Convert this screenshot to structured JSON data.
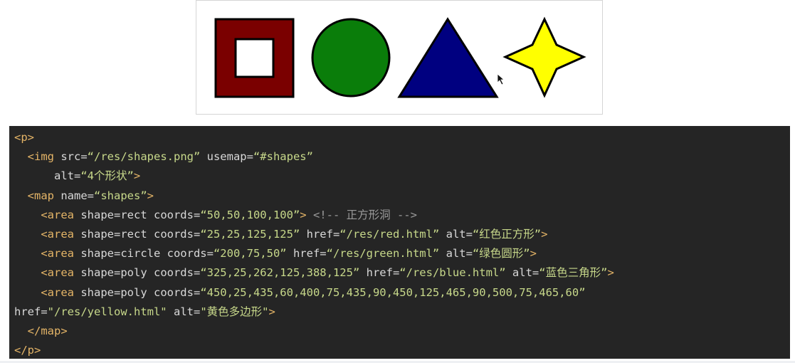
{
  "figure": {
    "shapes": [
      {
        "name": "red-square-frame",
        "fill": "#7a0000",
        "hole": "#ffffff"
      },
      {
        "name": "green-circle",
        "fill": "#0a7d0a"
      },
      {
        "name": "blue-triangle",
        "fill": "#000080"
      },
      {
        "name": "yellow-star",
        "fill": "#ffff00"
      }
    ],
    "stroke_color": "#000000"
  },
  "code": {
    "lines": [
      [
        {
          "t": "tag",
          "v": "<p>"
        }
      ],
      [
        {
          "t": "tag",
          "v": "  <img"
        },
        {
          "t": "attr",
          "v": " src="
        },
        {
          "t": "val",
          "v": "“/res/shapes.png”"
        },
        {
          "t": "attr",
          "v": " usemap="
        },
        {
          "t": "val",
          "v": "“#shapes”"
        }
      ],
      [
        {
          "t": "attr",
          "v": "      alt="
        },
        {
          "t": "val",
          "v": "“4个形状”"
        },
        {
          "t": "tag",
          "v": ">"
        }
      ],
      [
        {
          "t": "tag",
          "v": "  <map"
        },
        {
          "t": "attr",
          "v": " name="
        },
        {
          "t": "val",
          "v": "“shapes”"
        },
        {
          "t": "tag",
          "v": ">"
        }
      ],
      [
        {
          "t": "tag",
          "v": "    <area"
        },
        {
          "t": "attr",
          "v": " shape=rect coords="
        },
        {
          "t": "val",
          "v": "“50,50,100,100”"
        },
        {
          "t": "tag",
          "v": ">"
        },
        {
          "t": "cmt",
          "v": " <!-- 正方形洞 -->"
        }
      ],
      [
        {
          "t": "tag",
          "v": "    <area"
        },
        {
          "t": "attr",
          "v": " shape=rect coords="
        },
        {
          "t": "val",
          "v": "“25,25,125,125”"
        },
        {
          "t": "attr",
          "v": " href="
        },
        {
          "t": "val",
          "v": "“/res/red.html”"
        },
        {
          "t": "attr",
          "v": " alt="
        },
        {
          "t": "val",
          "v": "“红色正方形”"
        },
        {
          "t": "tag",
          "v": ">"
        }
      ],
      [
        {
          "t": "tag",
          "v": "    <area"
        },
        {
          "t": "attr",
          "v": " shape=circle coords="
        },
        {
          "t": "val",
          "v": "“200,75,50”"
        },
        {
          "t": "attr",
          "v": " href="
        },
        {
          "t": "val",
          "v": "“/res/green.html”"
        },
        {
          "t": "attr",
          "v": " alt="
        },
        {
          "t": "val",
          "v": "“绿色圆形”"
        },
        {
          "t": "tag",
          "v": ">"
        }
      ],
      [
        {
          "t": "tag",
          "v": "    <area"
        },
        {
          "t": "attr",
          "v": " shape=poly coords="
        },
        {
          "t": "val",
          "v": "“325,25,262,125,388,125”"
        },
        {
          "t": "attr",
          "v": " href="
        },
        {
          "t": "val",
          "v": "“/res/blue.html”"
        },
        {
          "t": "attr",
          "v": " alt="
        },
        {
          "t": "val",
          "v": "“蓝色三角形”"
        },
        {
          "t": "tag",
          "v": ">"
        }
      ],
      [
        {
          "t": "tag",
          "v": "    <area"
        },
        {
          "t": "attr",
          "v": " shape=poly coords="
        },
        {
          "t": "val",
          "v": "“450,25,435,60,400,75,435,90,450,125,465,90,500,75,465,60”"
        }
      ],
      [
        {
          "t": "attr",
          "v": "href="
        },
        {
          "t": "val",
          "v": "\"/res/yellow.html\""
        },
        {
          "t": "attr",
          "v": " alt="
        },
        {
          "t": "val",
          "v": "\"黄色多边形\""
        },
        {
          "t": "tag",
          "v": ">"
        }
      ],
      [
        {
          "t": "tag",
          "v": "  </map>"
        }
      ],
      [
        {
          "t": "tag",
          "v": "</p>"
        }
      ]
    ]
  }
}
